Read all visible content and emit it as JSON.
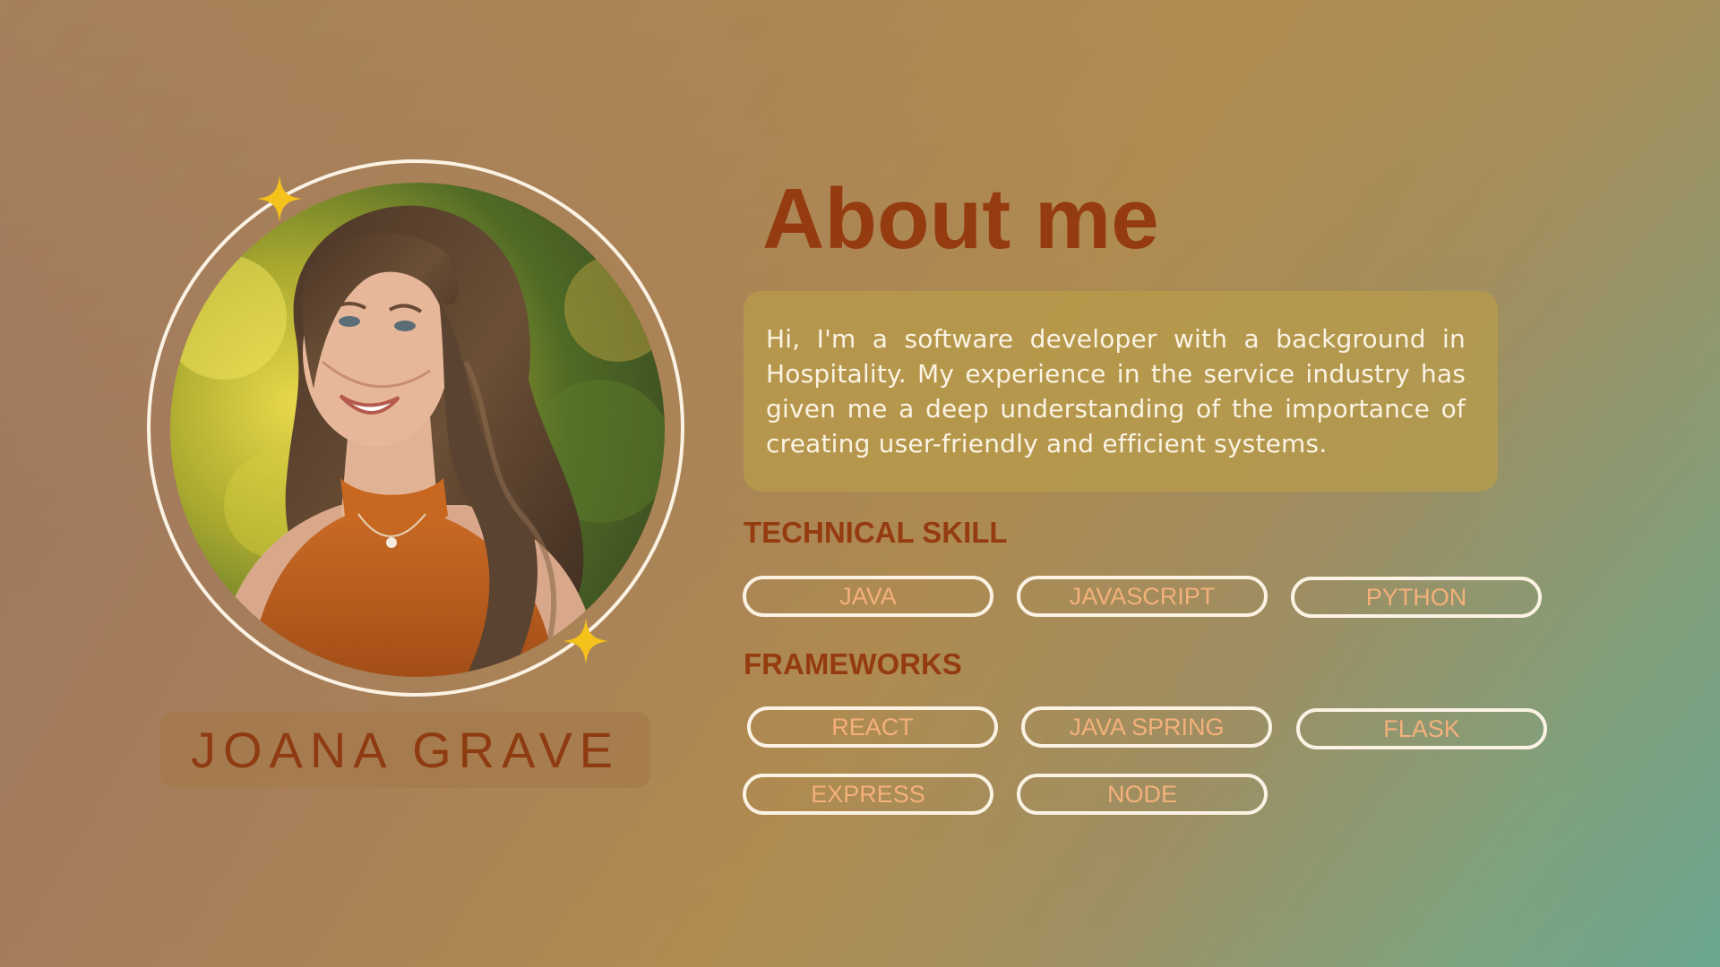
{
  "profile": {
    "name": "JOANA GRAVE",
    "photo_alt": "portrait"
  },
  "about": {
    "title": "About me",
    "bio": "Hi, I'm a software developer with a background in Hospitality. My experience in the service industry has given me a deep understanding of the importance of creating user-friendly and efficient systems."
  },
  "technical_skill": {
    "label": "TECHNICAL SKILL",
    "items": [
      "JAVA",
      "JAVASCRIPT",
      "PYTHON"
    ]
  },
  "frameworks": {
    "label": "FRAMEWORKS",
    "items": [
      "REACT",
      "JAVA SPRING",
      "FLASK",
      "EXPRESS",
      "NODE"
    ]
  },
  "icons": [
    "sparkle-icon",
    "sparkle-icon"
  ],
  "colors": {
    "title": "#953b10",
    "pill_text": "#f4b07a",
    "pill_border": "#fbf2e4",
    "bio_text": "#fbf3e3",
    "sparkle": "#f5c21b"
  }
}
